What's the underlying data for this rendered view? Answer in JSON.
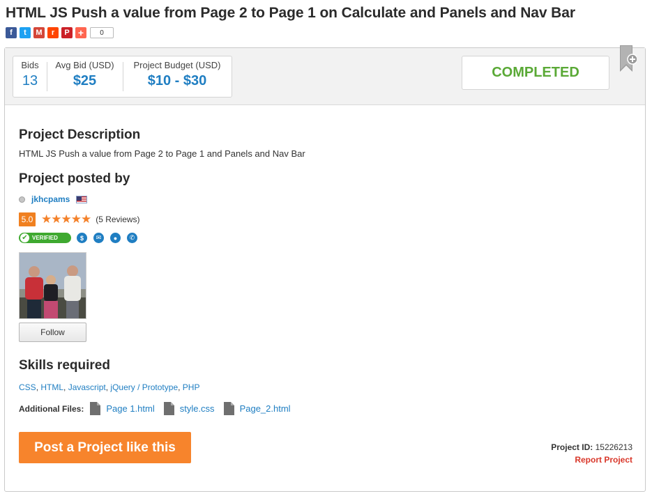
{
  "page": {
    "title": "HTML JS Push a value from Page 2 to Page 1 on Calculate and Panels and Nav Bar"
  },
  "share": {
    "icons": [
      "facebook-icon",
      "twitter-icon",
      "gmail-icon",
      "reddit-icon",
      "pinterest-icon",
      "addthis-icon"
    ],
    "glyphs": {
      "facebook": "f",
      "twitter": "t",
      "gmail": "M",
      "reddit": "r",
      "pinterest": "P",
      "add": "+"
    },
    "count": "0"
  },
  "stats": {
    "bids_label": "Bids",
    "bids_value": "13",
    "avg_label": "Avg Bid (USD)",
    "avg_value": "$25",
    "budget_label": "Project Budget (USD)",
    "budget_value": "$10 - $30"
  },
  "status": "COMPLETED",
  "description": {
    "heading": "Project Description",
    "text": "HTML JS Push a value from Page 2 to Page 1 and Panels and Nav Bar"
  },
  "poster": {
    "heading": "Project posted by",
    "name": "jkhcpams",
    "rating": "5.0",
    "stars": "★★★★★",
    "reviews": "(5 Reviews)",
    "verified_label": "VERIFIED",
    "follow_label": "Follow"
  },
  "skills": {
    "heading": "Skills required",
    "items": [
      "CSS",
      "HTML",
      "Javascript",
      "jQuery / Prototype",
      "PHP"
    ],
    "separator": ", "
  },
  "files": {
    "label": "Additional Files:",
    "items": [
      "Page 1.html",
      "style.css",
      "Page_2.html"
    ]
  },
  "actions": {
    "post_label": "Post a Project like this",
    "project_id_label": "Project ID:",
    "project_id": "15226213",
    "report_label": "Report Project"
  },
  "colors": {
    "accent_blue": "#1f7ec2",
    "completed_green": "#5aa936",
    "post_orange": "#f7842c",
    "report_red": "#d9372a",
    "star_orange": "#f4812a"
  }
}
